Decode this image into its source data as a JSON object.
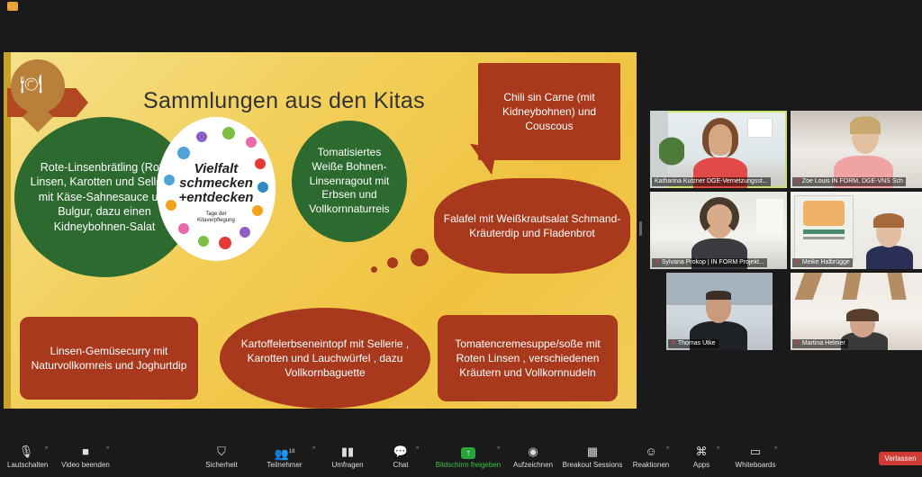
{
  "slide": {
    "title": "Sammlungen aus den Kitas",
    "logo": {
      "line1": "Vielfalt",
      "line2": "schmecken",
      "line3": "+entdecken",
      "line4": "Tage der",
      "line5": "Kitaverpflegung"
    },
    "green_left": "Rote-Linsenbrätling (Rote Linsen, Karotten und Sellerie) mit Käse-Sahnesauce und Bulgur, dazu einen Kidneybohnen-Salat",
    "green_right": "Tomatisiertes Weiße Bohnen-Linsenragout mit Erbsen und Vollkornnaturreis",
    "bubble_chili": "Chili sin Carne (mit Kidneybohnen) und Couscous",
    "bubble_falafel": "Falafel mit Weißkrautsalat Schmand- Kräuterdip und Fladenbrot",
    "bubble_linsen": "Linsen-Gemüsecurry mit Naturvollkornreis und Joghurtdip",
    "bubble_kartoffel": "Kartoffelerbseneintopf mit Sellerie , Karotten und Lauchwürfel , dazu Vollkornbaguette",
    "bubble_tomato": "Tomatencremesuppe/soße mit Roten Linsen , verschiedenen Kräutern und Vollkornnudeln"
  },
  "participants": [
    {
      "name": "Katharina Kutzner DGE-Vernetzungsst...",
      "muted": false,
      "active": true
    },
    {
      "name": "Zoe Louis IN FORM, DGE-VNS Sch",
      "muted": true,
      "active": false
    },
    {
      "name": "Sylvana Prokop | IN FORM Projekt...",
      "muted": true,
      "active": false
    },
    {
      "name": "Meike Halbrügge",
      "muted": true,
      "active": false
    },
    {
      "name": "Thomas Utke",
      "muted": true,
      "active": false
    },
    {
      "name": "Martina Helmer",
      "muted": true,
      "active": false
    }
  ],
  "toolbar": {
    "mute": "Lautschalten",
    "video": "Video beenden",
    "security": "Sicherheit",
    "participants": "Teilnehmer",
    "participants_count": "18",
    "polls": "Umfragen",
    "chat": "Chat",
    "share": "Bildschirm freigeben",
    "record": "Aufzeichnen",
    "breakout": "Breakout Sessions",
    "reactions": "Reaktionen",
    "apps": "Apps",
    "whiteboards": "Whiteboards",
    "leave": "Verlassen"
  },
  "colors": {
    "accent_active": "#c9e36a",
    "share_green": "#3fc247",
    "leave_red": "#d13b35",
    "bubble": "#a8391d",
    "green_circle": "#2d6a2f"
  }
}
